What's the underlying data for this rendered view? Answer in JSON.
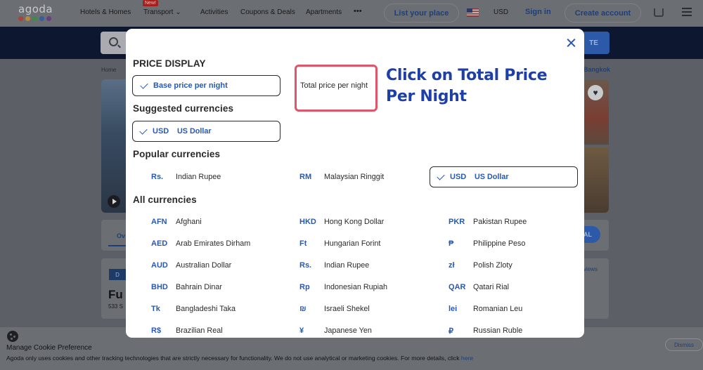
{
  "header": {
    "logo_text": "agoda",
    "logo_colors": [
      "#c0392b",
      "#e0a030",
      "#3aa050",
      "#2f6db5",
      "#7a3a9a"
    ],
    "nav": [
      "Hotels & Homes",
      "Transport",
      "Activities",
      "Coupons & Deals",
      "Apartments",
      "•••"
    ],
    "new_badge": "New!",
    "list_place": "List your place",
    "currency": "USD",
    "sign_in": "Sign in",
    "create_account": "Create account"
  },
  "search": {
    "button_label": "TE"
  },
  "breadcrumb": {
    "home": "Home",
    "right": "Bangkok"
  },
  "property": {
    "badge": "D",
    "name": "Fu",
    "address": "533 S",
    "reviews": "views",
    "overview_tab": "Ov",
    "select_label": "AL"
  },
  "cookie": {
    "title": "Manage Cookie Preference",
    "text": "Agoda only uses cookies and other tracking technologies that are strictly necessary for functionality. We do not use analytical or marketing cookies. For more details, click ",
    "link": "here",
    "dismiss": "Dismiss"
  },
  "modal": {
    "price_display_heading": "PRICE DISPLAY",
    "price_options": [
      {
        "label": "Base price per night",
        "selected": true
      },
      {
        "label": "Total price per night",
        "selected": false
      }
    ],
    "suggested_heading": "Suggested currencies",
    "suggested": [
      {
        "code": "USD",
        "name": "US Dollar",
        "selected": true
      }
    ],
    "popular_heading": "Popular currencies",
    "popular": [
      {
        "code": "Rs.",
        "name": "Indian Rupee"
      },
      {
        "code": "RM",
        "name": "Malaysian Ringgit"
      },
      {
        "code": "USD",
        "name": "US Dollar",
        "selected": true
      }
    ],
    "all_heading": "All currencies",
    "all": [
      [
        {
          "code": "AFN",
          "name": "Afghani"
        },
        {
          "code": "AED",
          "name": "Arab Emirates Dirham"
        },
        {
          "code": "AUD",
          "name": "Australian Dollar"
        },
        {
          "code": "BHD",
          "name": "Bahrain Dinar"
        },
        {
          "code": "Tk",
          "name": "Bangladeshi Taka"
        },
        {
          "code": "R$",
          "name": "Brazilian Real"
        }
      ],
      [
        {
          "code": "HKD",
          "name": "Hong Kong Dollar"
        },
        {
          "code": "Ft",
          "name": "Hungarian Forint"
        },
        {
          "code": "Rs.",
          "name": "Indian Rupee"
        },
        {
          "code": "Rp",
          "name": "Indonesian Rupiah"
        },
        {
          "code": "₪",
          "name": "Israeli Shekel"
        },
        {
          "code": "¥",
          "name": "Japanese Yen"
        }
      ],
      [
        {
          "code": "PKR",
          "name": "Pakistan Rupee"
        },
        {
          "code": "₱",
          "name": "Philippine Peso"
        },
        {
          "code": "zł",
          "name": "Polish Zloty"
        },
        {
          "code": "QAR",
          "name": "Qatari Rial"
        },
        {
          "code": "lei",
          "name": "Romanian Leu"
        },
        {
          "code": "₽",
          "name": "Russian Ruble"
        }
      ]
    ],
    "annotation": "Click on Total Price Per Night",
    "accent_color": "#2658b4",
    "highlight_color": "#e0556a"
  }
}
